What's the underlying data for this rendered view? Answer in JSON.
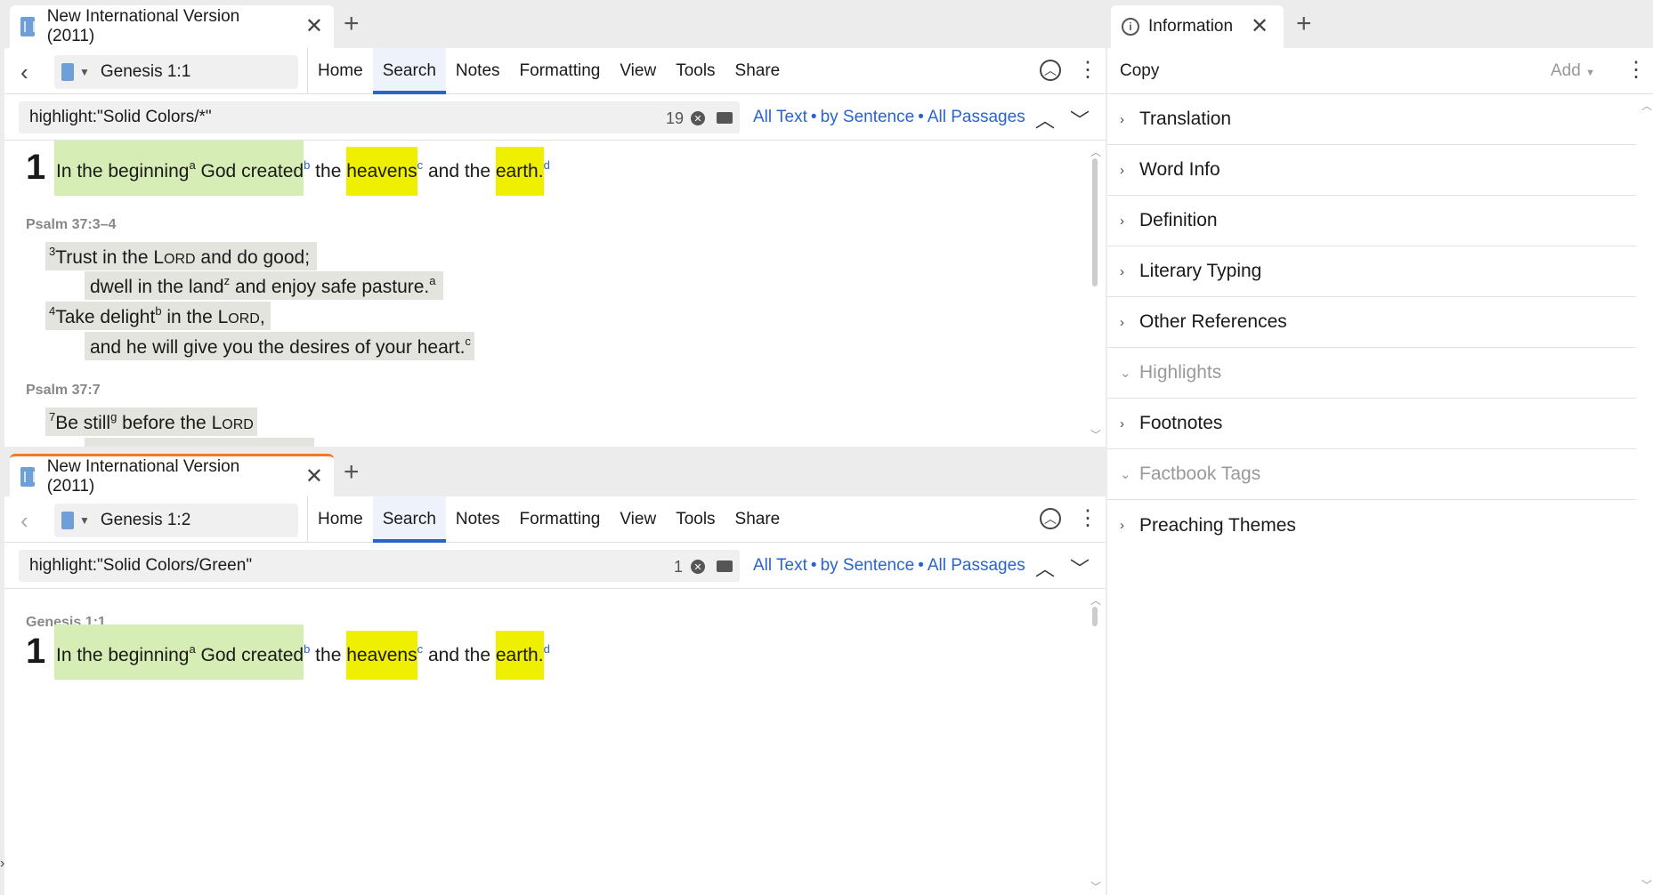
{
  "top_pane": {
    "tab_title": "New International Version (2011)",
    "reference": "Genesis 1:1",
    "menu": [
      "Home",
      "Search",
      "Notes",
      "Formatting",
      "View",
      "Tools",
      "Share"
    ],
    "search_query": "highlight:\"Solid Colors/*\"",
    "result_count": "19",
    "options": {
      "all_text": "All Text",
      "by_sentence": "by Sentence",
      "all_passages": "All Passages"
    },
    "verse_number": "1",
    "gen_segments": [
      "In the beginning",
      "a",
      " God created",
      "b",
      " the ",
      "heavens",
      "c",
      " and the ",
      "earth",
      ".",
      "d"
    ],
    "psalm_head_1": "Psalm 37:3–4",
    "psalm_lines": {
      "l1": {
        "sup": "3",
        "a": "Trust in the ",
        "lord_l": "L",
        "lord_rest": "ORD",
        "b": " and do good;"
      },
      "l2": {
        "a": "dwell in the land",
        "sup": "z",
        "b": " and enjoy safe pasture.",
        "sup2": "a"
      },
      "l3": {
        "sup": "4",
        "a": "Take delight",
        "sup2": "b",
        "b": " in the ",
        "lord_l": "L",
        "lord_rest": "ORD",
        "c": ","
      },
      "l4": {
        "a": "and he will give you the desires of your heart.",
        "sup": "c"
      }
    },
    "psalm_head_2": "Psalm 37:7",
    "psalm_line_5": {
      "sup": "7",
      "a": "Be still",
      "sup2": "g",
      "b": " before the ",
      "lord_l": "L",
      "lord_rest": "ORD"
    }
  },
  "bottom_pane": {
    "tab_title": "New International Version (2011)",
    "reference": "Genesis 1:2",
    "menu": [
      "Home",
      "Search",
      "Notes",
      "Formatting",
      "View",
      "Tools",
      "Share"
    ],
    "search_query": "highlight:\"Solid Colors/Green\"",
    "result_count": "1",
    "options": {
      "all_text": "All Text",
      "by_sentence": "by Sentence",
      "all_passages": "All Passages"
    },
    "ref_head": "Genesis 1:1",
    "verse_number": "1",
    "gen_segments": [
      "In the beginning",
      "a",
      " God created",
      "b",
      " the ",
      "heavens",
      "c",
      " and the ",
      "earth",
      ".",
      "d"
    ]
  },
  "info_pane": {
    "tab_title": "Information",
    "copy_label": "Copy",
    "add_label": "Add",
    "sections": [
      {
        "label": "Translation",
        "dim": false
      },
      {
        "label": "Word Info",
        "dim": false
      },
      {
        "label": "Definition",
        "dim": false
      },
      {
        "label": "Literary Typing",
        "dim": false
      },
      {
        "label": "Other References",
        "dim": false
      },
      {
        "label": "Highlights",
        "dim": true
      },
      {
        "label": "Footnotes",
        "dim": false
      },
      {
        "label": "Factbook Tags",
        "dim": true
      },
      {
        "label": "Preaching Themes",
        "dim": false
      }
    ]
  },
  "colors": {
    "accent": "#2a64c9",
    "highlight_green": "#d6edb5",
    "highlight_yellow": "#efef00",
    "highlight_grey": "#e3e4de",
    "active_tab_border": "#f07a2a"
  }
}
